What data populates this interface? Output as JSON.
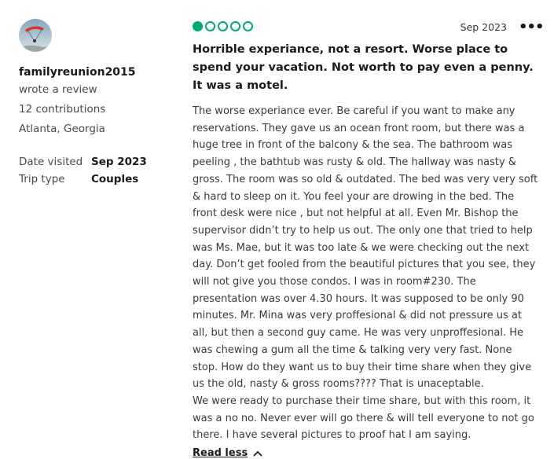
{
  "reviewer": {
    "username": "familyreunion2015",
    "action": "wrote a review",
    "contributions": "12 contributions",
    "location": "Atlanta, Georgia"
  },
  "visit": {
    "date_label": "Date visited",
    "date_value": "Sep 2023",
    "trip_label": "Trip type",
    "trip_value": "Couples"
  },
  "review": {
    "rating": 1,
    "rating_max": 5,
    "date": "Sep 2023",
    "title": "Horrible experiance, not a resort. Worse place to spend your vacation. Not worth to pay even a penny. It was a motel.",
    "paragraphs": [
      "The worse experiance ever. Be careful if you want to make any reservations. They gave us an ocean front room, but there was a huge tree in front of the balcony & the sea. The bathroom was peeling , the bathtub was rusty & old. The hallway was nasty & gross. The room was so old & outdated. The bed was very very soft & hard to sleep on it. You feel your are drowing in the bed. The front desk were nice , but not helpful at all. Even Mr. Bishop the supervisor didn’t try to help us out. The only one that tried to help was Ms. Mae, but it was too late & we were checking out the next day. Don’t get fooled from the beautiful pictures that you see, they will not give you those condos. I was in room#230. The presentation was over 4.30 hours. It was supposed to be only 90 minutes. Mr. Mina was very proffesional & did not pressure us at all, but then a second guy came. He was very unproffesional. He was chewing a gum all the time & talking very very fast. None stop. How do they want us to buy their time share when they give us the old, nasty & gross rooms???? That is unaceptable.",
      "We were ready to purchase their time share, but with this room, it was a no no. Never ever will go there & will tell everyone to not go there. I have several pictures to proof hat I am saying."
    ],
    "read_less_label": "Read less"
  },
  "icons": {
    "avatar": "avatar-paraglider-image",
    "more": "more-options-icon",
    "chevron": "chevron-up-icon"
  },
  "colors": {
    "rating_green": "#00aa6c",
    "text_dark": "#1b1b1b"
  }
}
